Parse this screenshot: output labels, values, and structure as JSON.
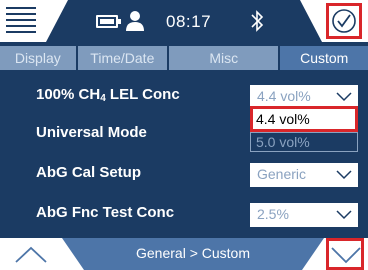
{
  "status_bar": {
    "time": "08:17",
    "icons": [
      "menu-icon",
      "battery-icon",
      "user-icon",
      "bluetooth-icon",
      "checkmark-icon"
    ]
  },
  "tabs": [
    {
      "label": "Display",
      "active": false
    },
    {
      "label": "Time/Date",
      "active": false
    },
    {
      "label": "Misc",
      "active": false
    },
    {
      "label": "Custom",
      "active": true
    }
  ],
  "rows": {
    "lel_conc": {
      "label_main": "100% CH",
      "label_sub": "4",
      "label_tail": " LEL Conc",
      "value": "4.4 vol%"
    },
    "universal_mode": {
      "label": "Universal Mode"
    },
    "abg_cal_setup": {
      "label": "AbG Cal Setup",
      "value": "Generic"
    },
    "abg_fnc_test": {
      "label": "AbG Fnc Test Conc",
      "value": "2.5%"
    }
  },
  "dropdown": {
    "options": [
      "4.4 vol%",
      "5.0 vol%"
    ],
    "selected": "4.4 vol%"
  },
  "bottom_bar": {
    "breadcrumb": "General > Custom"
  },
  "colors": {
    "background": "#1b3b63",
    "tab_inactive": "#7f9bbd",
    "tab_active": "#4d75a8",
    "highlight": "#d9262a"
  }
}
